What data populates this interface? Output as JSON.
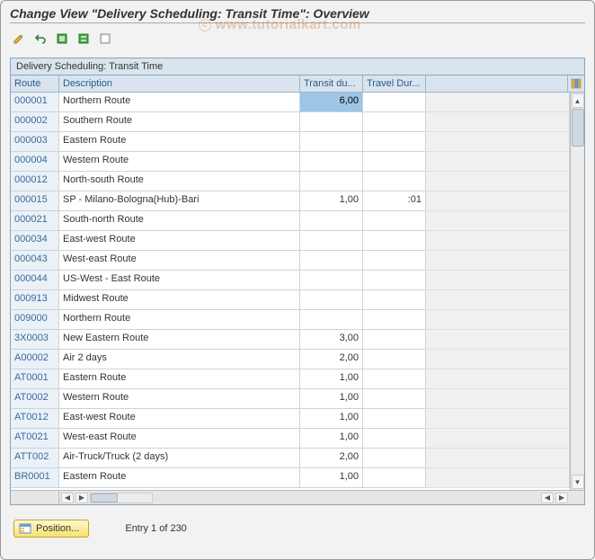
{
  "title": "Change View \"Delivery Scheduling: Transit Time\": Overview",
  "watermark": "www.tutorialkart.com",
  "panel_title": "Delivery Scheduling: Transit Time",
  "columns": {
    "route": "Route",
    "description": "Description",
    "transit": "Transit du...",
    "travel": "Travel Dur..."
  },
  "rows": [
    {
      "route": "000001",
      "desc": "Northern Route",
      "tdur": "6,00",
      "travel": "",
      "selected": true
    },
    {
      "route": "000002",
      "desc": "Southern Route",
      "tdur": "",
      "travel": ""
    },
    {
      "route": "000003",
      "desc": "Eastern Route",
      "tdur": "",
      "travel": ""
    },
    {
      "route": "000004",
      "desc": "Western Route",
      "tdur": "",
      "travel": ""
    },
    {
      "route": "000012",
      "desc": "North-south Route",
      "tdur": "",
      "travel": ""
    },
    {
      "route": "000015",
      "desc": "SP - Milano-Bologna(Hub)-Bari",
      "tdur": "1,00",
      "travel": ":01"
    },
    {
      "route": "000021",
      "desc": "South-north Route",
      "tdur": "",
      "travel": ""
    },
    {
      "route": "000034",
      "desc": "East-west Route",
      "tdur": "",
      "travel": ""
    },
    {
      "route": "000043",
      "desc": "West-east Route",
      "tdur": "",
      "travel": ""
    },
    {
      "route": "000044",
      "desc": "US-West - East Route",
      "tdur": "",
      "travel": ""
    },
    {
      "route": "000913",
      "desc": "Midwest Route",
      "tdur": "",
      "travel": ""
    },
    {
      "route": "009000",
      "desc": "Northern Route",
      "tdur": "",
      "travel": ""
    },
    {
      "route": "3X0003",
      "desc": "New Eastern Route",
      "tdur": "3,00",
      "travel": ""
    },
    {
      "route": "A00002",
      "desc": "Air 2 days",
      "tdur": "2,00",
      "travel": ""
    },
    {
      "route": "AT0001",
      "desc": "Eastern Route",
      "tdur": "1,00",
      "travel": ""
    },
    {
      "route": "AT0002",
      "desc": "Western Route",
      "tdur": "1,00",
      "travel": ""
    },
    {
      "route": "AT0012",
      "desc": "East-west Route",
      "tdur": "1,00",
      "travel": ""
    },
    {
      "route": "AT0021",
      "desc": "West-east Route",
      "tdur": "1,00",
      "travel": ""
    },
    {
      "route": "ATT002",
      "desc": "Air-Truck/Truck (2 days)",
      "tdur": "2,00",
      "travel": ""
    },
    {
      "route": "BR0001",
      "desc": "Eastern Route",
      "tdur": "1,00",
      "travel": ""
    }
  ],
  "footer": {
    "position_label": "Position...",
    "entry_text": "Entry 1 of 230"
  }
}
